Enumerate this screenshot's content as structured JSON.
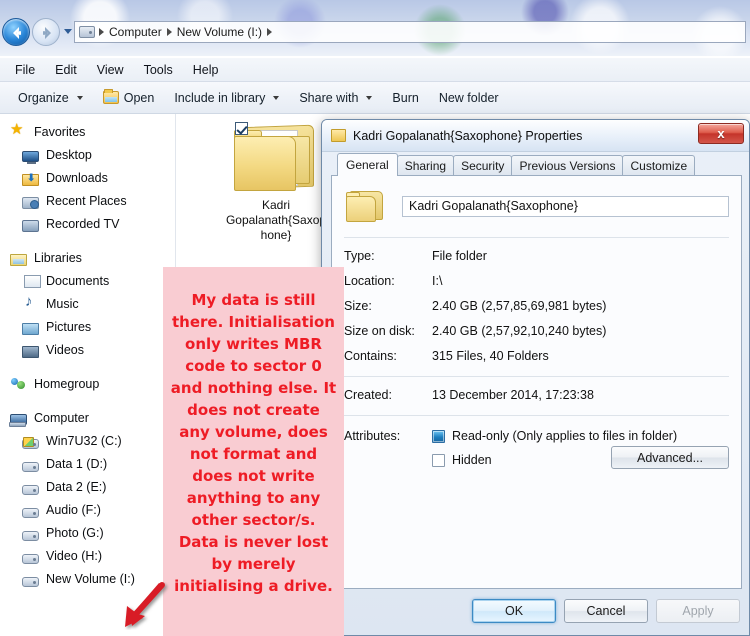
{
  "window": {
    "address": {
      "drive_icon": "drive-icon",
      "crumbs": [
        "Computer",
        "New Volume (I:)"
      ]
    },
    "nav": {
      "back_icon": "back-arrow-icon",
      "forward_icon": "forward-arrow-icon",
      "history_icon": "chevron-down-icon"
    },
    "menubar": [
      "File",
      "Edit",
      "View",
      "Tools",
      "Help"
    ],
    "toolbar": [
      {
        "label": "Organize",
        "caret": true,
        "icon": null
      },
      {
        "label": "Open",
        "caret": false,
        "icon": "open-folder-icon"
      },
      {
        "label": "Include in library",
        "caret": true,
        "icon": null
      },
      {
        "label": "Share with",
        "caret": true,
        "icon": null
      },
      {
        "label": "Burn",
        "caret": false,
        "icon": null
      },
      {
        "label": "New folder",
        "caret": false,
        "icon": null
      }
    ]
  },
  "sidebar": {
    "groups": [
      {
        "label": "Favorites",
        "icon": "star-icon",
        "items": [
          {
            "label": "Desktop",
            "icon": "monitor-icon"
          },
          {
            "label": "Downloads",
            "icon": "download-folder-icon"
          },
          {
            "label": "Recent Places",
            "icon": "recent-places-icon"
          },
          {
            "label": "Recorded TV",
            "icon": "recorded-tv-icon"
          }
        ]
      },
      {
        "label": "Libraries",
        "icon": "library-icon",
        "items": [
          {
            "label": "Documents",
            "icon": "documents-icon"
          },
          {
            "label": "Music",
            "icon": "music-icon"
          },
          {
            "label": "Pictures",
            "icon": "pictures-icon"
          },
          {
            "label": "Videos",
            "icon": "videos-icon"
          }
        ]
      },
      {
        "label": "Homegroup",
        "icon": "homegroup-icon",
        "items": []
      },
      {
        "label": "Computer",
        "icon": "computer-icon",
        "items": [
          {
            "label": "Win7U32 (C:)",
            "icon": "windows-drive-icon"
          },
          {
            "label": "Data 1 (D:)",
            "icon": "drive-icon"
          },
          {
            "label": "Data 2 (E:)",
            "icon": "drive-icon"
          },
          {
            "label": "Audio (F:)",
            "icon": "drive-icon"
          },
          {
            "label": "Photo (G:)",
            "icon": "drive-icon"
          },
          {
            "label": "Video (H:)",
            "icon": "drive-icon"
          },
          {
            "label": "New Volume (I:)",
            "icon": "drive-icon"
          }
        ]
      }
    ]
  },
  "content": {
    "tile": {
      "label": "Kadri Gopalanath{Saxophone}",
      "checkbox_checked": true,
      "icon": "folder-icon"
    }
  },
  "dialog": {
    "title": "Kadri Gopalanath{Saxophone} Properties",
    "title_icon": "folder-icon",
    "close_label": "x",
    "tabs": [
      {
        "label": "General",
        "active": true
      },
      {
        "label": "Sharing",
        "active": false
      },
      {
        "label": "Security",
        "active": false
      },
      {
        "label": "Previous Versions",
        "active": false
      },
      {
        "label": "Customize",
        "active": false
      }
    ],
    "name_value": "Kadri Gopalanath{Saxophone}",
    "properties": [
      {
        "label": "Type:",
        "value": "File folder"
      },
      {
        "label": "Location:",
        "value": "I:\\"
      },
      {
        "label": "Size:",
        "value": "2.40 GB (2,57,85,69,981 bytes)"
      },
      {
        "label": "Size on disk:",
        "value": "2.40 GB (2,57,92,10,240 bytes)"
      },
      {
        "label": "Contains:",
        "value": "315 Files, 40 Folders"
      }
    ],
    "created": {
      "label": "Created:",
      "value": "13 December 2014, 17:23:38"
    },
    "attributes": {
      "label": "Attributes:",
      "readonly_label": "Read-only (Only applies to files in folder)",
      "readonly_state": "filled",
      "hidden_label": "Hidden",
      "hidden_state": "unchecked",
      "advanced_label": "Advanced..."
    },
    "buttons": [
      {
        "label": "OK",
        "style": "default"
      },
      {
        "label": "Cancel",
        "style": "normal"
      },
      {
        "label": "Apply",
        "style": "disabled"
      }
    ]
  },
  "annotation": {
    "text": "My data is still there. Initialisation only writes MBR code to sector 0 and nothing else. It does not create any volume, does not format and does not write anything to any other sector/s. Data is never lost by merely initialising a drive.",
    "background_color": "#f9ccd2",
    "text_color": "#ee1c25",
    "arrow_color": "#d81f26"
  }
}
